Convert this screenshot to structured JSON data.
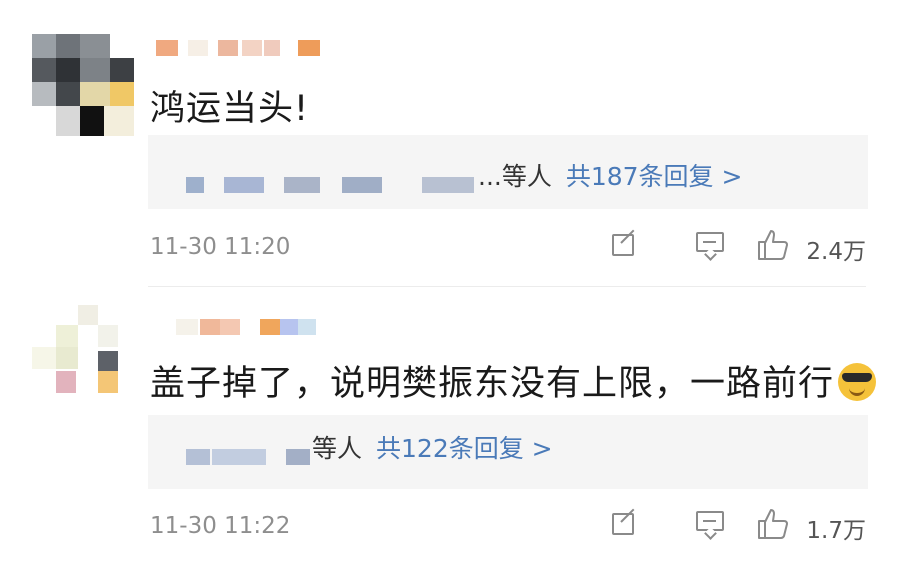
{
  "comments": [
    {
      "text": "鸿运当头!",
      "reply_who": "...等人",
      "reply_count": "共187条回复 >",
      "timestamp": "11-30 11:20",
      "likes": "2.4万",
      "has_emoji": false
    },
    {
      "text": "盖子掉了，说明樊振东没有上限，一路前行",
      "reply_who": "等人",
      "reply_count": "共122条回复 >",
      "timestamp": "11-30 11:22",
      "likes": "1.7万",
      "has_emoji": true,
      "emoji_name": "sunglasses-emoji"
    }
  ],
  "icons": [
    "share-icon",
    "comment-icon",
    "like-icon"
  ],
  "colors": {
    "reply_link": "#4a7ab8",
    "meta_text": "#8e8e8e",
    "reply_bg": "#f5f5f5"
  }
}
